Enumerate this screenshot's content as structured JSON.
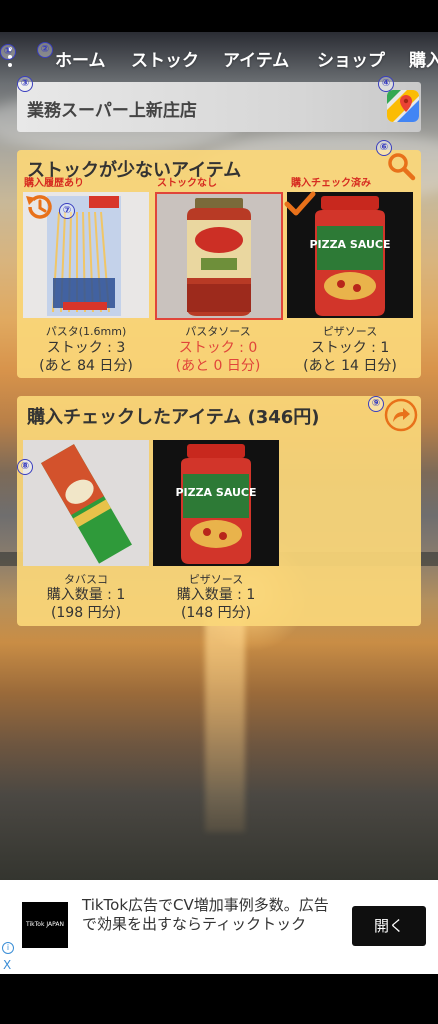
{
  "nav": {
    "markers": [
      "①",
      "②"
    ],
    "tabs": [
      "ホーム",
      "ストック",
      "アイテム",
      "ショップ",
      "購入"
    ]
  },
  "store": {
    "marker": "③",
    "name": "業務スーパー上新庄店",
    "maps_marker": "④",
    "maps_icon": "google-maps-icon"
  },
  "low_stock": {
    "title": "ストックが少ないアイテム",
    "search_marker": "⑥",
    "history_marker": "⑦",
    "items": [
      {
        "tag": "購入履歴あり",
        "label": "パスタ(1.6mm)",
        "stock": "ストック : 3",
        "days": "(あと 84 日分)",
        "highlight": false
      },
      {
        "tag": "ストックなし",
        "label": "パスタソース",
        "stock": "ストック : 0",
        "days": "(あと 0 日分)",
        "highlight": true
      },
      {
        "tag": "購入チェック済み",
        "label": "ピザソース",
        "stock": "ストック : 1",
        "days": "(あと 14 日分)",
        "highlight": false
      }
    ]
  },
  "purchase": {
    "title": "購入チェックしたアイテム (346円)",
    "share_marker": "⑨",
    "item_marker": "⑧",
    "items": [
      {
        "label": "タバスコ",
        "qty": "購入数量 : 1",
        "price": "(198 円分)"
      },
      {
        "label": "ピザソース",
        "qty": "購入数量 : 1",
        "price": "(148 円分)"
      }
    ]
  },
  "ad": {
    "text": "TikTok広告でCV増加事例多数。広告で効果を出すならティックトック",
    "open_label": "開く",
    "logo_text": "TikTok JAPAN",
    "info_label": "i",
    "close_label": "X"
  },
  "colors": {
    "card": "#fad678",
    "accent": "#e8711a",
    "alert": "#e0453a",
    "marker": "#3a3fbf"
  }
}
